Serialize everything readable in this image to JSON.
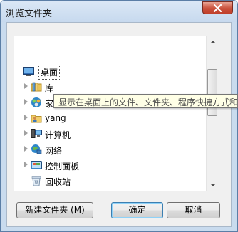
{
  "window": {
    "title": "浏览文件夹"
  },
  "tree": {
    "items": [
      {
        "label": "桌面",
        "icon": "desktop-icon",
        "selected": true
      },
      {
        "label": "库",
        "icon": "library-icon"
      },
      {
        "label": "家",
        "icon": "homegroup-icon"
      },
      {
        "label": "yang",
        "icon": "user-folder-icon"
      },
      {
        "label": "计算机",
        "icon": "computer-icon"
      },
      {
        "label": "网络",
        "icon": "network-icon"
      },
      {
        "label": "控制面板",
        "icon": "control-panel-icon"
      },
      {
        "label": "回收站",
        "icon": "recycle-bin-icon"
      }
    ]
  },
  "tooltip": {
    "text": "显示在桌面上的文件、文件夹、程序快捷方式和"
  },
  "buttons": {
    "new_folder": "新建文件夹 (M)",
    "ok": "确定",
    "cancel": "取消"
  }
}
